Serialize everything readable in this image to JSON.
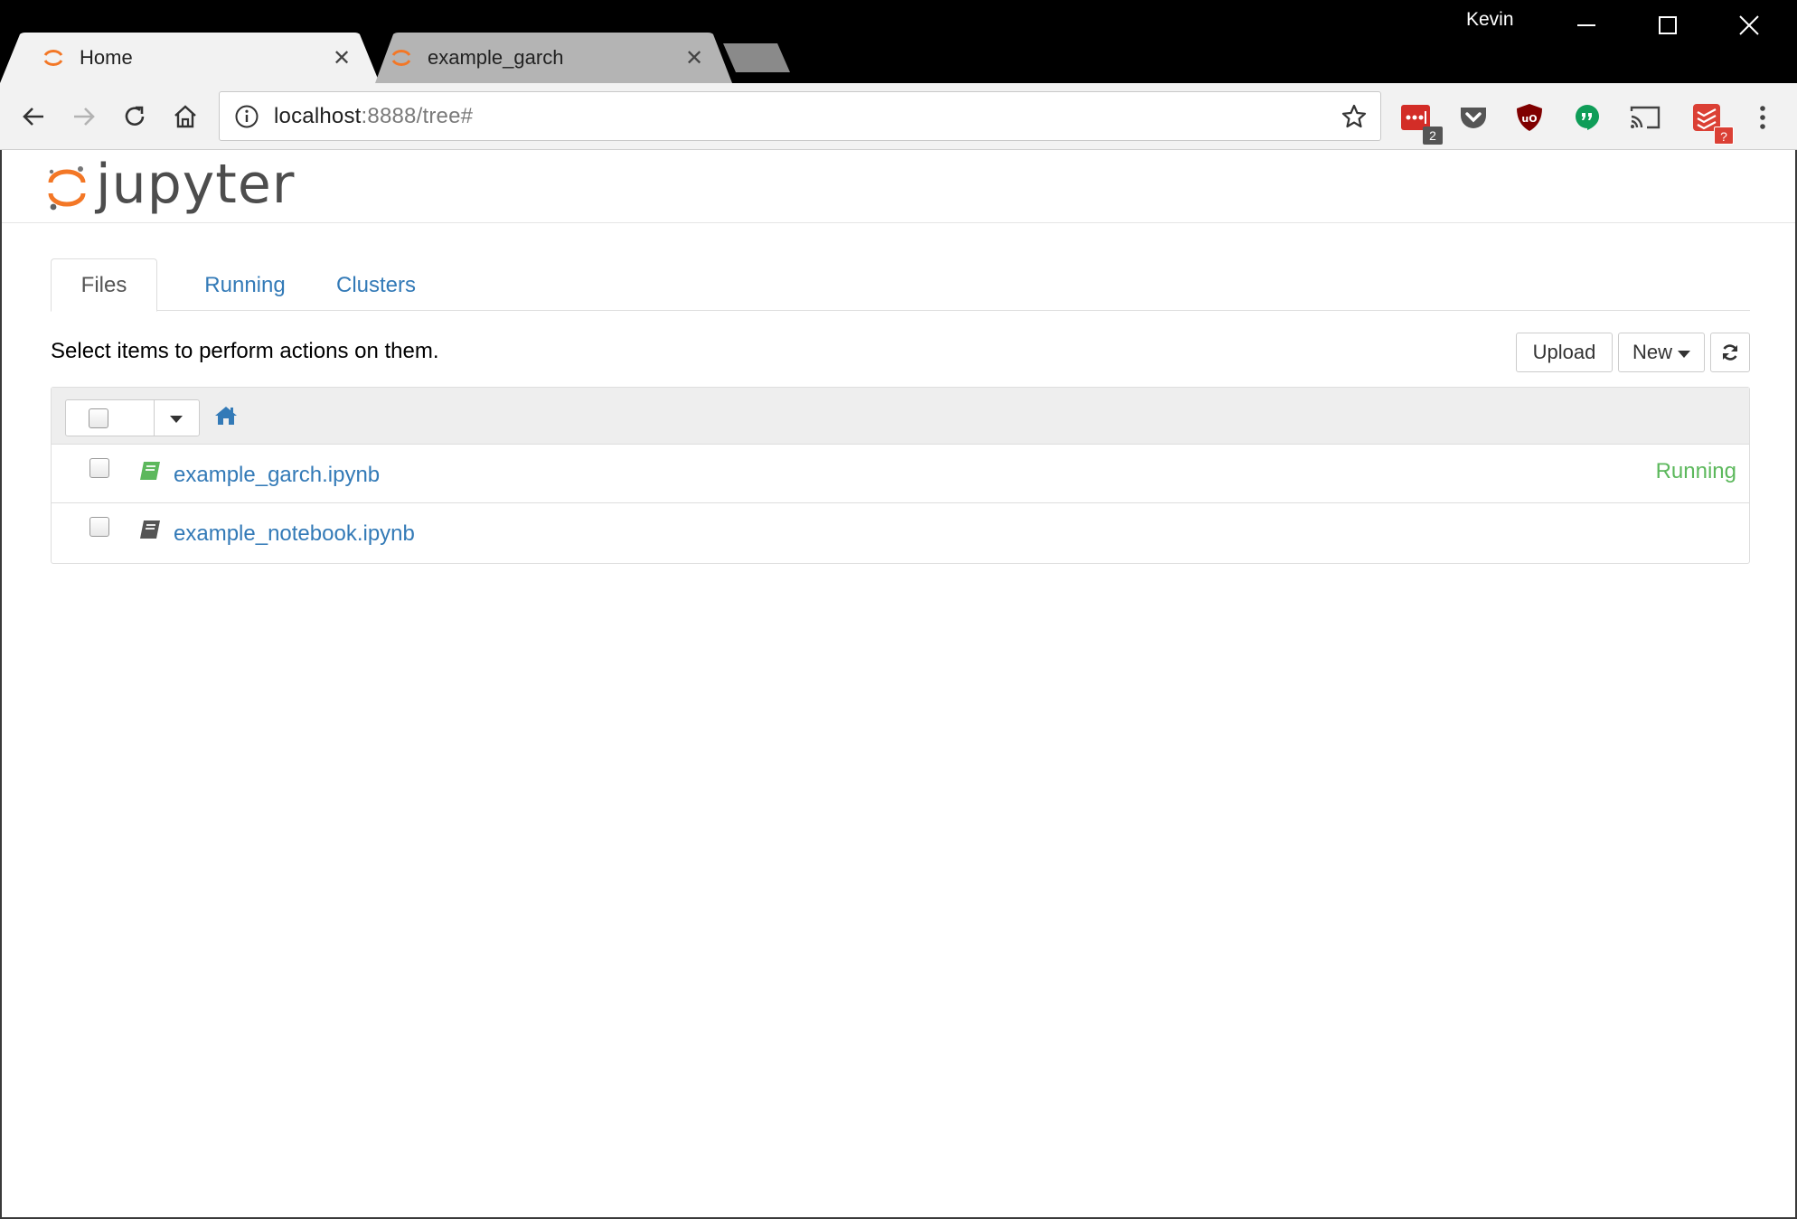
{
  "browser": {
    "profile_name": "Kevin",
    "tabs": [
      {
        "title": "Home",
        "active": true,
        "close_label": "✕"
      },
      {
        "title": "example_garch",
        "active": false,
        "close_label": "✕"
      }
    ],
    "url_host": "localhost",
    "url_rest": ":8888/tree#",
    "extensions": [
      {
        "name": "lastpass-icon",
        "badge": "2",
        "color": "#d32d27"
      },
      {
        "name": "pocket-icon",
        "badge": "",
        "color": "#555555"
      },
      {
        "name": "ublock-icon",
        "badge": "",
        "color": "#800000"
      },
      {
        "name": "hangouts-icon",
        "badge": "",
        "color": "#0f9d58"
      },
      {
        "name": "cast-icon",
        "badge": "",
        "color": "#444444"
      },
      {
        "name": "todoist-icon",
        "badge": "?",
        "color": "#db4035"
      }
    ]
  },
  "jupyter": {
    "logo_text": "jupyter",
    "nav_tabs": [
      "Files",
      "Running",
      "Clusters"
    ],
    "instructions": "Select items to perform actions on them.",
    "upload_label": "Upload",
    "new_label": "New",
    "files": [
      {
        "name": "example_garch.ipynb",
        "status": "Running",
        "icon": "notebook-running-icon",
        "icon_color": "#5cb85c"
      },
      {
        "name": "example_notebook.ipynb",
        "status": "",
        "icon": "notebook-icon",
        "icon_color": "#555555"
      }
    ],
    "colors": {
      "link": "#337ab7",
      "running": "#5cb85c",
      "logo_orange": "#f37726"
    }
  }
}
